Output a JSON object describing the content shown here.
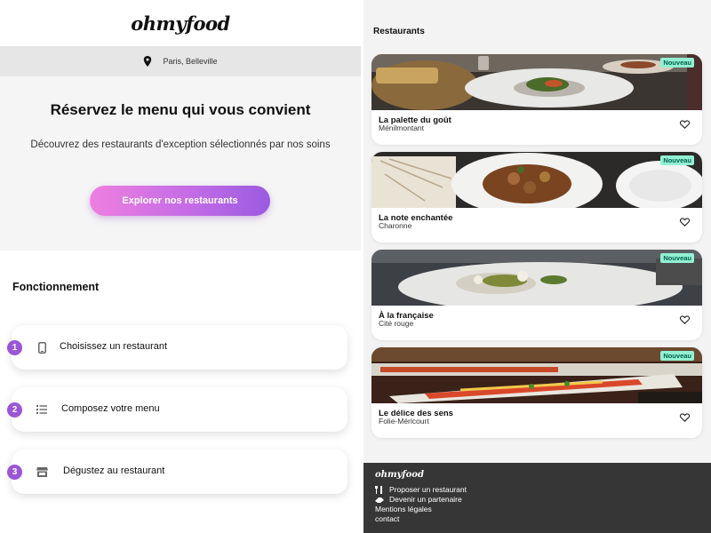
{
  "brand": {
    "logo": "ohmyfood"
  },
  "location": {
    "icon": "map-marker-icon",
    "text": "Paris, Belleville"
  },
  "hero": {
    "title": "Réservez le menu qui vous convient",
    "subtitle": "Découvrez des restaurants d'exception sélectionnés par nos soins",
    "cta_label": "Explorer nos restaurants"
  },
  "how": {
    "title": "Fonctionnement",
    "steps": [
      {
        "number": "1",
        "icon": "mobile-phone-icon",
        "label": "Choisissez un restaurant"
      },
      {
        "number": "2",
        "icon": "list-icon",
        "label": "Composez votre menu"
      },
      {
        "number": "3",
        "icon": "store-icon",
        "label": "Dégustez au restaurant"
      }
    ]
  },
  "restaurants": {
    "title": "Restaurants",
    "cards": [
      {
        "name": "La palette du goût",
        "area": "Ménilmontant",
        "badge": "Nouveau"
      },
      {
        "name": "La note enchantée",
        "area": "Charonne",
        "badge": "Nouveau"
      },
      {
        "name": "À la française",
        "area": "Cité rouge",
        "badge": "Nouveau"
      },
      {
        "name": "Le délice des sens",
        "area": "Folie-Méricourt",
        "badge": "Nouveau"
      }
    ]
  },
  "footer": {
    "logo": "ohmyfood",
    "links": [
      {
        "icon": "utensils-icon",
        "label": "Proposer un restaurant"
      },
      {
        "icon": "handshake-icon",
        "label": "Devenir un partenaire"
      },
      {
        "icon": "",
        "label": "Mentions légales"
      },
      {
        "icon": "",
        "label": "contact"
      }
    ]
  },
  "colors": {
    "accent_gradient_start": "#ee7fe0",
    "accent_gradient_end": "#9a5be0",
    "step_number": "#9a56d6",
    "badge_bg": "#93f0d2",
    "badge_text": "#00614b",
    "footer_bg": "#363636"
  }
}
